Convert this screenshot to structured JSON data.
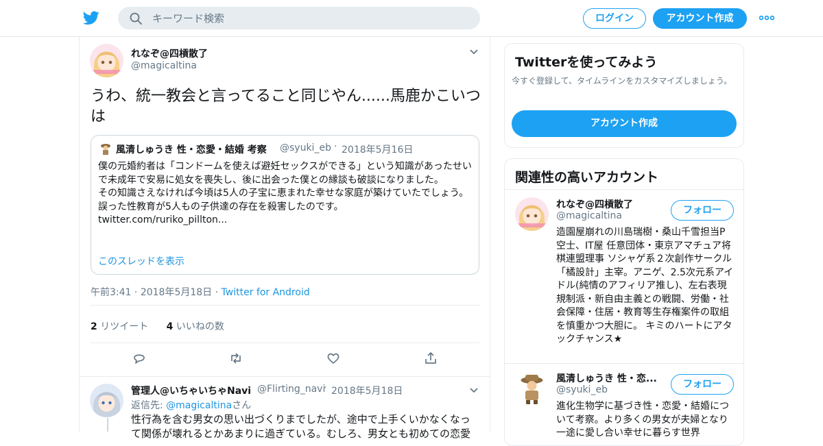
{
  "header": {
    "search_placeholder": "キーワード検索",
    "login_label": "ログイン",
    "signup_label": "アカウント作成"
  },
  "tweet": {
    "author_name": "れなぞ@四槓散了",
    "author_handle": "@magicaltina",
    "text": "うわ、統一教会と言ってること同じやん......馬鹿かこいつは",
    "quote": {
      "author_name": "風清しゅうき 性・恋愛・結婚 考察",
      "author_handle": "@syuki_eb",
      "date": "2018年5月16日",
      "text": "僕の元婚約者は「コンドームを使えば避妊セックスができる」という知識があったせいで未成年で安易に処女を喪失し、後に出会った僕との縁談も破談になりました。\nその知識さえなければ今頃は5人の子宝に恵まれた幸せな家庭が築けていたでしょう。\n誤った性教育が5人もの子供達の存在を殺害したのです。\ntwitter.com/ruriko_pillton...",
      "thread_link": "このスレッドを表示"
    },
    "time": "午前3:41",
    "date": "2018年5月18日",
    "via": "Twitter for Android",
    "retweets_count": "2",
    "retweets_label": "リツイート",
    "likes_count": "4",
    "likes_label": "いいねの数"
  },
  "reply": {
    "author_name": "管理人@いちゃいちゃNavi",
    "author_handle": "@Flirting_navi",
    "date": "2018年5月18日",
    "reply_prefix": "返信先: ",
    "reply_to": "@magicaltina",
    "reply_suffix": "さん",
    "text": "性行為を含む男女の思い出づくりまでしたが、途中で上手くいかなくなって関係が壊れるとかあまりに過ぎている。むしろ、男女とも初めての恋愛"
  },
  "sidebar": {
    "try_card": {
      "title": "Twitterを使ってみよう",
      "subtitle": "今すぐ登録して、タイムラインをカスタマイズしましょう。",
      "button": "アカウント作成"
    },
    "related": {
      "title": "関連性の高いアカウント",
      "follow_label": "フォロー",
      "accounts": [
        {
          "name": "れなぞ@四槓散了",
          "handle": "@magicaltina",
          "bio": "造園屋崩れの川島瑞樹・桑山千雪担当P空士、IT屋 任意団体・東京アマチュア将棋連盟理事 ソシャゲ系２次創作サークル「橘設計」主宰。アニゲ、2.5次元系アイドル(純情のアフィリア推し)、左右表現規制派・新自由主義との戦闘、労働・社会保障・住居・教育等生存権案件の取組を慎重かつ大胆に。 キミのハートにアタックチャンス★"
        },
        {
          "name": "風清しゅうき 性・恋...",
          "handle": "@syuki_eb",
          "bio": "進化生物学に基づき性・恋愛・結婚について考察。より多くの男女が夫婦となり一途に愛し合い幸せに暮らす世界"
        }
      ]
    }
  },
  "colors": {
    "accent": "#1da1f2",
    "link": "#1b95e0",
    "muted": "#657786",
    "border": "#e6ecf0"
  },
  "icons": [
    "twitter-bird-icon",
    "search-icon",
    "more-dots-icon",
    "chevron-down-icon",
    "reply-icon",
    "retweet-icon",
    "like-heart-icon",
    "share-icon"
  ]
}
